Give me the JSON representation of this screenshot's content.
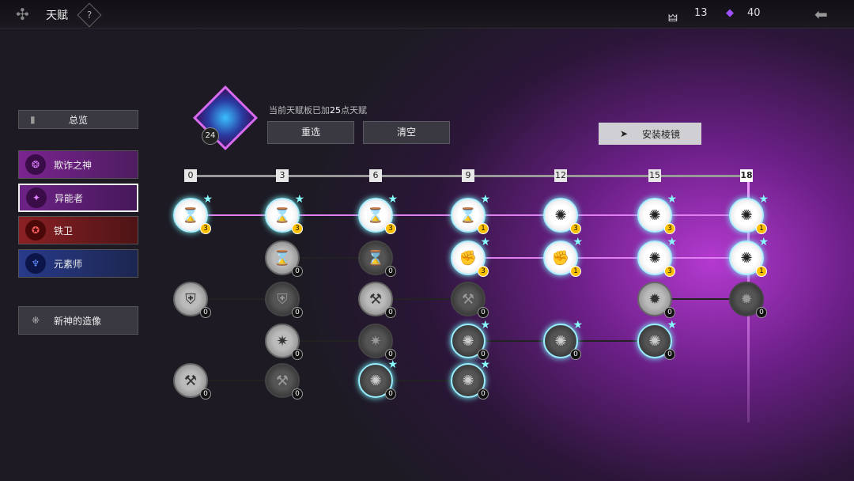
{
  "header": {
    "title": "天赋",
    "help": "?",
    "res1": "13",
    "res2": "40"
  },
  "sidebar": {
    "overview": "总览",
    "items": [
      "欺诈之神",
      "异能者",
      "铁卫",
      "元素师"
    ],
    "statue": "新神的造像"
  },
  "panel": {
    "level": "24",
    "desc_pre": "当前天赋板已加",
    "desc_num": "25",
    "desc_post": "点天赋",
    "reset": "重选",
    "clear": "清空",
    "prism": "安装棱镜"
  },
  "ticks": [
    "0",
    "3",
    "6",
    "9",
    "12",
    "15",
    "18"
  ],
  "nodes": [
    {
      "c": 0,
      "r": 0,
      "n": "3",
      "t": "lit",
      "i": "⌛",
      "star": true
    },
    {
      "c": 1,
      "r": 0,
      "n": "3",
      "t": "lit",
      "i": "⌛",
      "star": true
    },
    {
      "c": 2,
      "r": 0,
      "n": "3",
      "t": "lit",
      "i": "⌛",
      "star": true
    },
    {
      "c": 3,
      "r": 0,
      "n": "1",
      "t": "lit",
      "i": "⌛",
      "star": true
    },
    {
      "c": 4,
      "r": 0,
      "n": "3",
      "t": "lit",
      "i": "✺",
      "star": false
    },
    {
      "c": 5,
      "r": 0,
      "n": "3",
      "t": "lit",
      "i": "✺",
      "star": true
    },
    {
      "c": 6,
      "r": 0,
      "n": "1",
      "t": "lit",
      "i": "✺",
      "star": true
    },
    {
      "c": 1,
      "r": 1,
      "n": "0",
      "t": "dim",
      "i": "⌛",
      "star": false
    },
    {
      "c": 2,
      "r": 1,
      "n": "0",
      "t": "dark",
      "i": "⌛",
      "star": false
    },
    {
      "c": 3,
      "r": 1,
      "n": "3",
      "t": "lit",
      "i": "✊",
      "star": true
    },
    {
      "c": 4,
      "r": 1,
      "n": "1",
      "t": "lit",
      "i": "✊",
      "star": true
    },
    {
      "c": 5,
      "r": 1,
      "n": "3",
      "t": "lit",
      "i": "✺",
      "star": true
    },
    {
      "c": 6,
      "r": 1,
      "n": "1",
      "t": "lit",
      "i": "✺",
      "star": true
    },
    {
      "c": 0,
      "r": 2,
      "n": "0",
      "t": "dim",
      "i": "⛨",
      "star": false
    },
    {
      "c": 1,
      "r": 2,
      "n": "0",
      "t": "dark",
      "i": "⛨",
      "star": false
    },
    {
      "c": 2,
      "r": 2,
      "n": "0",
      "t": "dim",
      "i": "⚒",
      "star": false
    },
    {
      "c": 3,
      "r": 2,
      "n": "0",
      "t": "dark",
      "i": "⚒",
      "star": false
    },
    {
      "c": 5,
      "r": 2,
      "n": "0",
      "t": "dim",
      "i": "✹",
      "star": false
    },
    {
      "c": 6,
      "r": 2,
      "n": "0",
      "t": "dark",
      "i": "✹",
      "star": false
    },
    {
      "c": 1,
      "r": 3,
      "n": "0",
      "t": "dim",
      "i": "✷",
      "star": false
    },
    {
      "c": 2,
      "r": 3,
      "n": "0",
      "t": "dark",
      "i": "✷",
      "star": false
    },
    {
      "c": 3,
      "r": 3,
      "n": "0",
      "t": "dark lit",
      "i": "✺",
      "star": true
    },
    {
      "c": 4,
      "r": 3,
      "n": "0",
      "t": "dark lit",
      "i": "✺",
      "star": true
    },
    {
      "c": 5,
      "r": 3,
      "n": "0",
      "t": "dark lit",
      "i": "✺",
      "star": true
    },
    {
      "c": 0,
      "r": 4,
      "n": "0",
      "t": "dim",
      "i": "⚒",
      "star": false
    },
    {
      "c": 1,
      "r": 4,
      "n": "0",
      "t": "dark",
      "i": "⚒",
      "star": false
    },
    {
      "c": 2,
      "r": 4,
      "n": "0",
      "t": "dark lit",
      "i": "✺",
      "star": true
    },
    {
      "c": 3,
      "r": 4,
      "n": "0",
      "t": "dark lit",
      "i": "✺",
      "star": true
    }
  ],
  "links": [
    [
      0,
      0,
      1,
      true
    ],
    [
      1,
      0,
      2,
      true
    ],
    [
      2,
      0,
      3,
      true
    ],
    [
      3,
      0,
      4,
      true
    ],
    [
      4,
      0,
      5,
      true
    ],
    [
      5,
      0,
      6,
      true
    ],
    [
      1,
      1,
      2,
      false
    ],
    [
      3,
      1,
      4,
      true
    ],
    [
      4,
      1,
      5,
      true
    ],
    [
      5,
      1,
      6,
      true
    ],
    [
      0,
      2,
      1,
      false
    ],
    [
      2,
      2,
      3,
      false
    ],
    [
      5,
      2,
      6,
      false
    ],
    [
      1,
      3,
      2,
      false
    ],
    [
      3,
      3,
      4,
      false
    ],
    [
      4,
      3,
      5,
      false
    ],
    [
      0,
      4,
      1,
      false
    ],
    [
      2,
      4,
      3,
      false
    ]
  ]
}
